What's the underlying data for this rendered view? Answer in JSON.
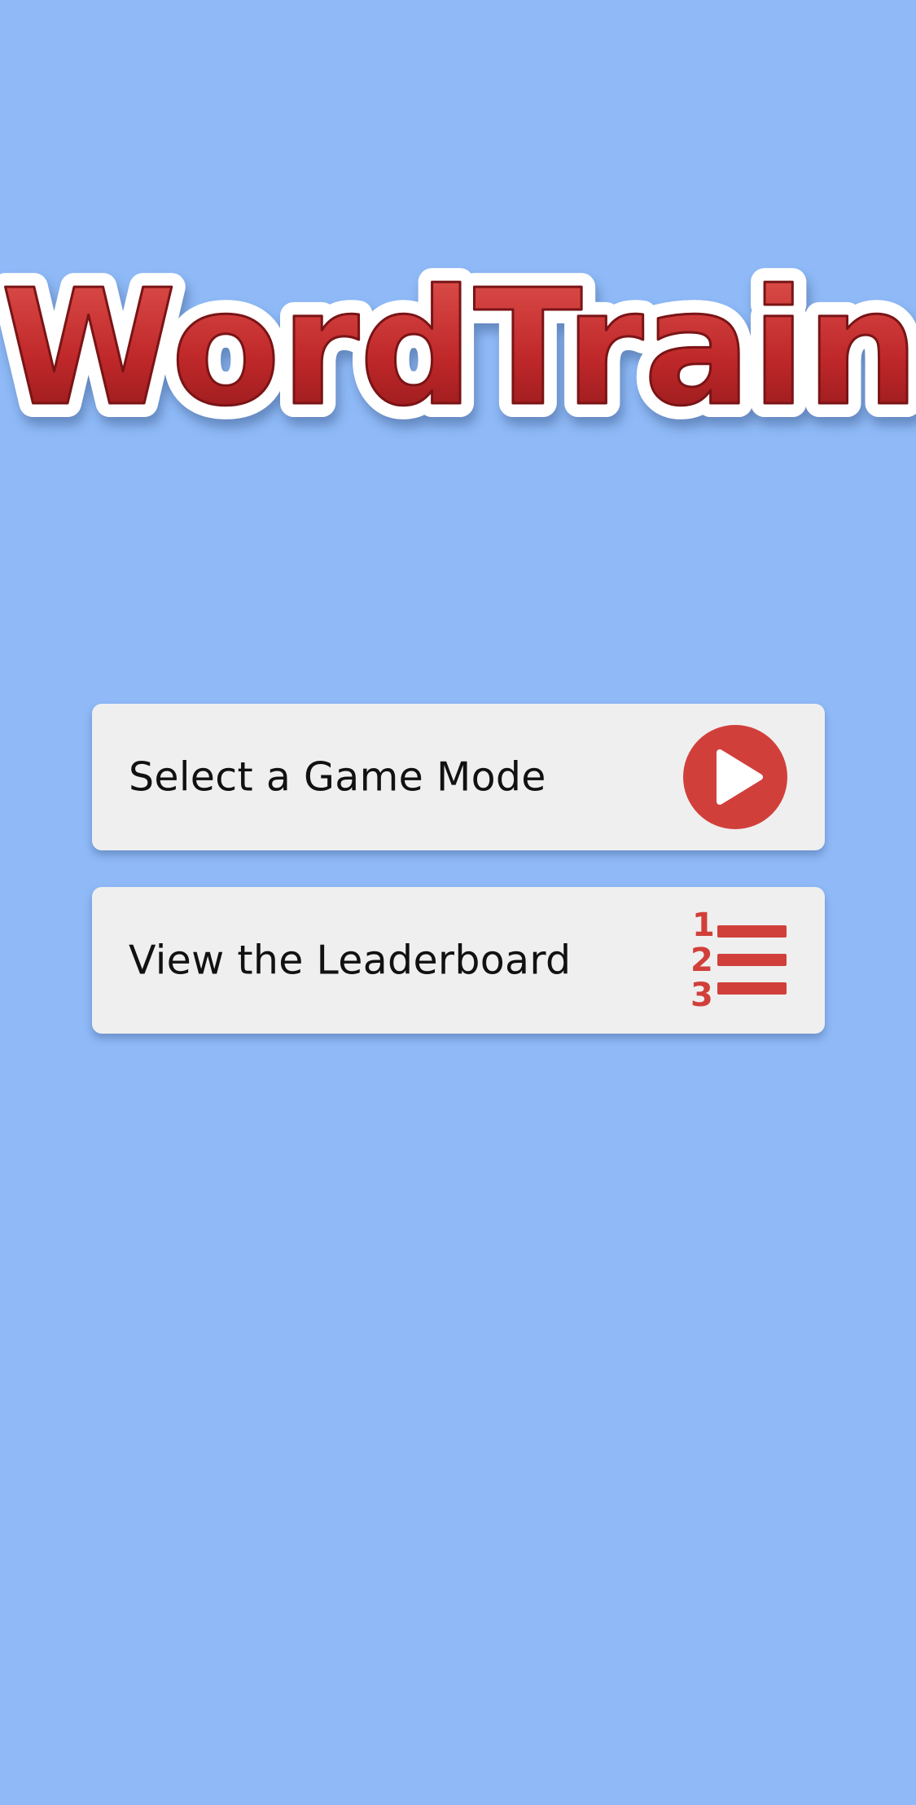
{
  "app": {
    "logo_text": "WordTrain"
  },
  "menu": {
    "items": [
      {
        "label": "Select a Game Mode",
        "icon": "play-icon"
      },
      {
        "label": "View the Leaderboard",
        "icon": "leaderboard-list-icon"
      }
    ]
  },
  "colors": {
    "background": "#8fbaf7",
    "card": "#efefef",
    "accent_red": "#d13f3b",
    "logo_red": "#c0282a",
    "text": "#111111"
  }
}
